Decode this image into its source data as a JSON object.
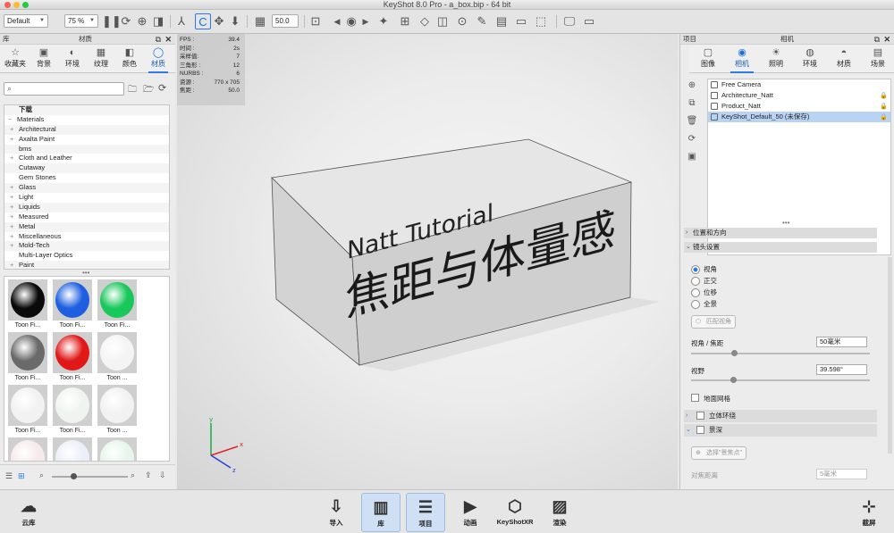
{
  "window": {
    "title": "KeyShot 8.0 Pro  - a_box.bip  - 64 bit"
  },
  "toolbar": {
    "preset": "Default",
    "zoom": "75 %",
    "value_field": "50.0"
  },
  "library": {
    "title": "库",
    "subtitle": "材质",
    "tabs": [
      {
        "label": "收藏夹",
        "icon": "☆"
      },
      {
        "label": "背景",
        "icon": "▣"
      },
      {
        "label": "环境",
        "icon": "◐"
      },
      {
        "label": "纹理",
        "icon": "▦"
      },
      {
        "label": "颜色",
        "icon": "◧"
      },
      {
        "label": "材质",
        "icon": "◯"
      }
    ],
    "search_placeholder": "",
    "tree": [
      {
        "label": "下载",
        "exp": "",
        "indent": 1
      },
      {
        "label": "Materials",
        "exp": "−",
        "indent": 0
      },
      {
        "label": "Architectural",
        "exp": "+",
        "indent": 1
      },
      {
        "label": "Axalta Paint",
        "exp": "+",
        "indent": 1
      },
      {
        "label": "bms",
        "exp": "",
        "indent": 1
      },
      {
        "label": "Cloth and Leather",
        "exp": "+",
        "indent": 1
      },
      {
        "label": "Cutaway",
        "exp": "",
        "indent": 1
      },
      {
        "label": "Gem Stones",
        "exp": "",
        "indent": 1
      },
      {
        "label": "Glass",
        "exp": "+",
        "indent": 1
      },
      {
        "label": "Light",
        "exp": "+",
        "indent": 1
      },
      {
        "label": "Liquids",
        "exp": "+",
        "indent": 1
      },
      {
        "label": "Measured",
        "exp": "+",
        "indent": 1
      },
      {
        "label": "Metal",
        "exp": "+",
        "indent": 1
      },
      {
        "label": "Miscellaneous",
        "exp": "+",
        "indent": 1
      },
      {
        "label": "Mold-Tech",
        "exp": "+",
        "indent": 1
      },
      {
        "label": "Multi-Layer Optics",
        "exp": "",
        "indent": 1
      },
      {
        "label": "Paint",
        "exp": "+",
        "indent": 1
      }
    ],
    "swatches": [
      {
        "label": "Toon Fi...",
        "color": "#0a0a0a"
      },
      {
        "label": "Toon Fi...",
        "color": "#1d5fe0"
      },
      {
        "label": "Toon Fi...",
        "color": "#18c85a"
      },
      {
        "label": "Toon Fi...",
        "color": "#6a6a6a"
      },
      {
        "label": "Toon Fi...",
        "color": "#e01818"
      },
      {
        "label": "Toon ...",
        "color": "#f4f4f4"
      },
      {
        "label": "Toon Fi...",
        "color": "#f2f2f2"
      },
      {
        "label": "Toon Fi...",
        "color": "#f0f4f0"
      },
      {
        "label": "Toon ...",
        "color": "#f2f2f2"
      },
      {
        "label": "Toon ...",
        "color": "#f6eaea"
      },
      {
        "label": "Toon ...",
        "color": "#eaf0f8"
      },
      {
        "label": "Toon ...",
        "color": "#e6f6ea"
      }
    ]
  },
  "hud": {
    "rows": [
      {
        "k": "FPS :",
        "v": "39.4"
      },
      {
        "k": "时间 :",
        "v": "2s"
      },
      {
        "k": "采样值:",
        "v": "7"
      },
      {
        "k": "三角形 :",
        "v": "12"
      },
      {
        "k": "NURBS :",
        "v": "6"
      },
      {
        "k": "资源 :",
        "v": "770 x 705"
      },
      {
        "k": "焦距 :",
        "v": "50.0"
      }
    ]
  },
  "scene": {
    "line1": "Natt Tutorial",
    "line2": "焦距与体量感"
  },
  "axes": {
    "x": "x",
    "y": "y",
    "z": "z"
  },
  "project": {
    "title": "项目",
    "subtitle": "相机",
    "tabs": [
      {
        "label": "图像",
        "icon": "▢"
      },
      {
        "label": "相机",
        "icon": "◉"
      },
      {
        "label": "照明",
        "icon": "☀"
      },
      {
        "label": "环境",
        "icon": "◍"
      },
      {
        "label": "材质",
        "icon": "◓"
      },
      {
        "label": "场景",
        "icon": "▤"
      }
    ],
    "cameras": [
      {
        "label": "Free Camera",
        "lock": ""
      },
      {
        "label": "Architecture_Natt",
        "lock": "🔒"
      },
      {
        "label": "Product_Natt",
        "lock": "🔒"
      },
      {
        "label": "KeyShot_Default_50 (未保存)",
        "lock": "🔒"
      }
    ],
    "sections": {
      "position": "位置和方向",
      "lens": "镜头设置",
      "stereo": "立体环绕",
      "dof": "景深"
    },
    "lens": {
      "options": [
        "视角",
        "正交",
        "位移",
        "全景"
      ],
      "match_button": "匹配视角",
      "focal_label": "视角 / 焦距",
      "focal_value": "50毫米",
      "fov_label": "视野",
      "fov_value": "39.598°",
      "ground_grid": "地面网格"
    },
    "dof": {
      "select_button": "选择\"景焦点\"",
      "distance_label": "对焦距离",
      "distance_value": "5毫米"
    }
  },
  "bottom": {
    "left": {
      "label": "云库"
    },
    "buttons": [
      {
        "label": "导入",
        "icon": "⇩"
      },
      {
        "label": "库",
        "icon": "▥"
      },
      {
        "label": "项目",
        "icon": "☰"
      },
      {
        "label": "动画",
        "icon": "▶"
      },
      {
        "label": "KeyShotXR",
        "icon": "⬡"
      },
      {
        "label": "渲染",
        "icon": "▨"
      }
    ],
    "right": {
      "label": "截屏"
    }
  }
}
